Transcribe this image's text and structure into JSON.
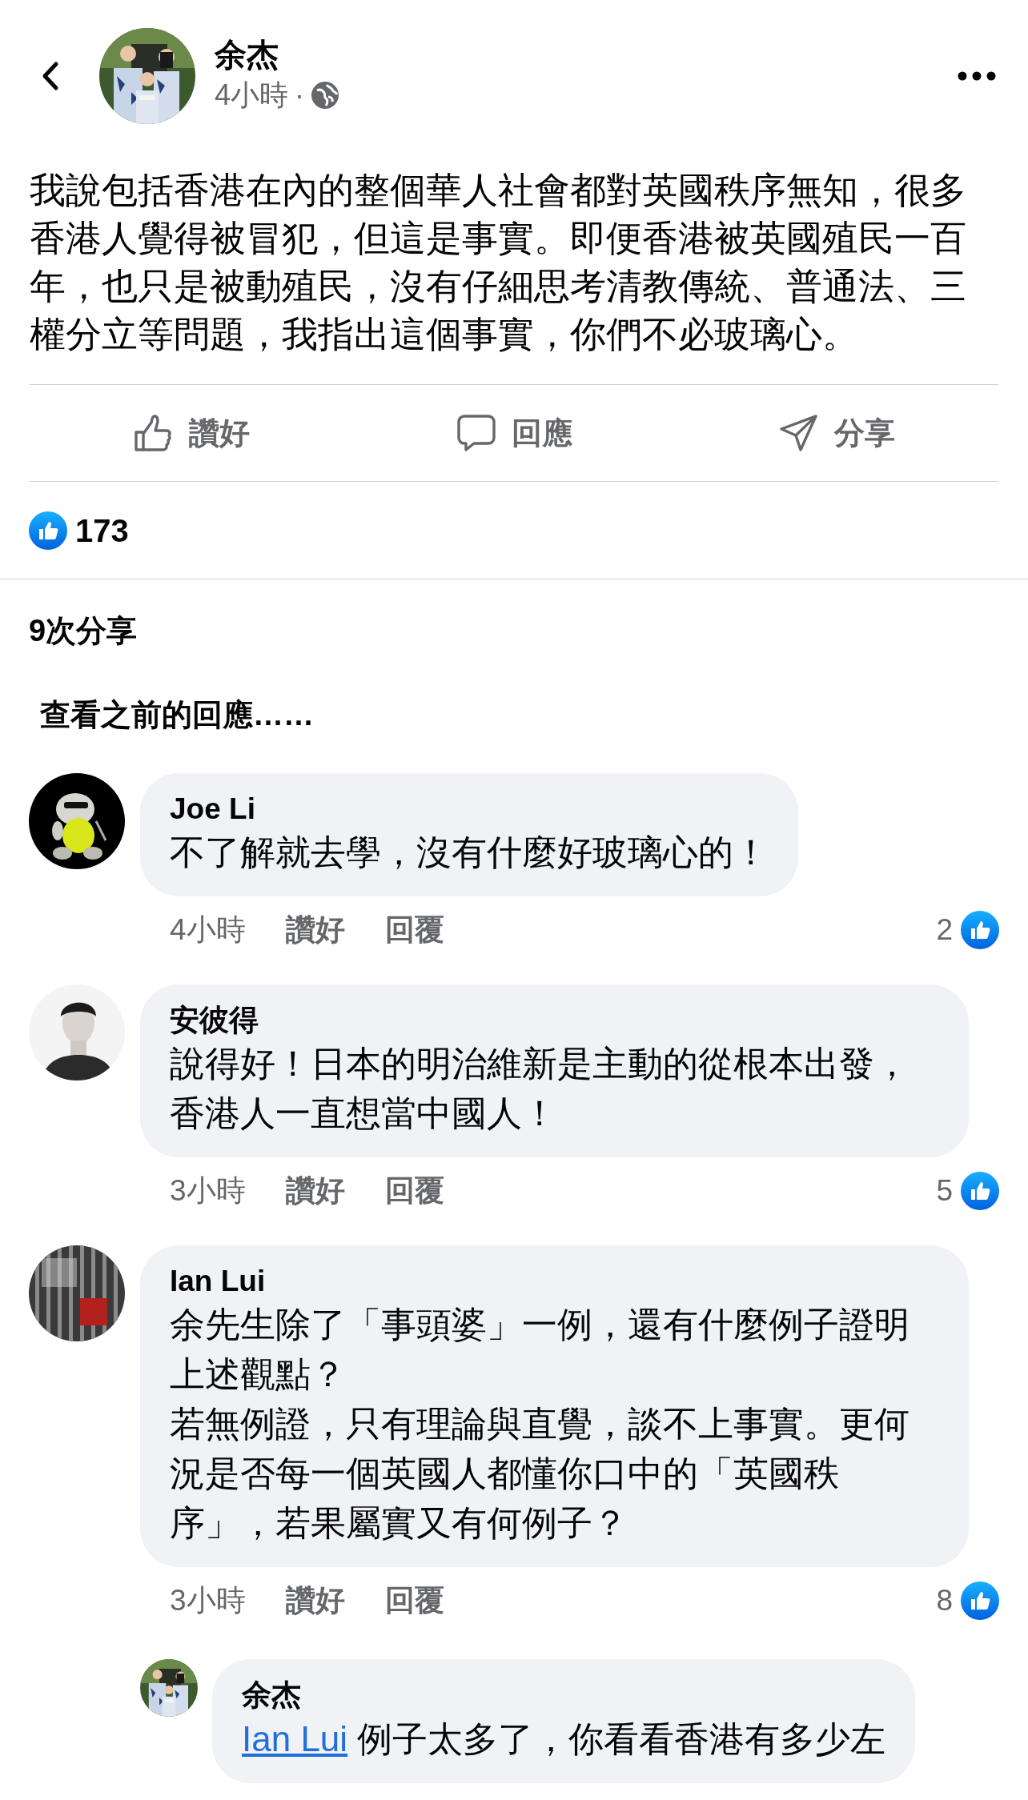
{
  "header": {
    "author": "余杰",
    "time": "4小時",
    "separator": "·"
  },
  "post": {
    "text": "我說包括香港在內的整個華人社會都對英國秩序無知，很多香港人覺得被冒犯，但這是事實。即便香港被英國殖民一百年，也只是被動殖民，沒有仔細思考清教傳統、普通法、三權分立等問題，我指出這個事實，你們不必玻璃心。"
  },
  "actions": [
    {
      "kind": "like",
      "label": "讚好"
    },
    {
      "kind": "comment",
      "label": "回應"
    },
    {
      "kind": "share",
      "label": "分享"
    }
  ],
  "reactions": {
    "count": "173"
  },
  "shares": "9次分享",
  "previous_comments": "查看之前的回應……",
  "comments": [
    {
      "author": "Joe Li",
      "paragraphs": [
        "不了解就去學，沒有什麼好玻璃心的！"
      ],
      "time": "4小時",
      "like_label": "讚好",
      "reply_label": "回覆",
      "like_count": "2"
    },
    {
      "author": "安彼得",
      "paragraphs": [
        "說得好！日本的明治維新是主動的從根本出發，香港人一直想當中國人！"
      ],
      "time": "3小時",
      "like_label": "讚好",
      "reply_label": "回覆",
      "like_count": "5"
    },
    {
      "author": "Ian Lui",
      "paragraphs": [
        "余先生除了「事頭婆」一例，還有什麼例子證明上述觀點？",
        "若無例證，只有理論與直覺，談不上事實。更何況是否每一個英國人都懂你口中的「英國秩序」，若果屬實又有何例子？"
      ],
      "time": "3小時",
      "like_label": "讚好",
      "reply_label": "回覆",
      "like_count": "8",
      "replies": [
        {
          "author": "余杰",
          "mention": "Ian Lui",
          "text": "例子太多了，你看看香港有多少左"
        }
      ]
    }
  ]
}
